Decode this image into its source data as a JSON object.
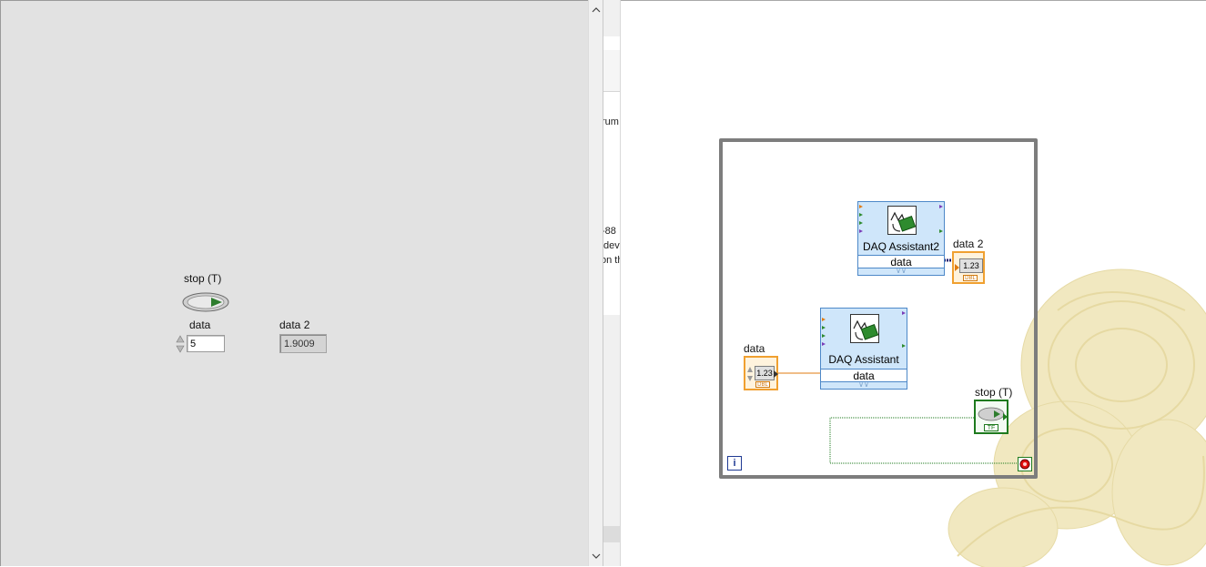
{
  "front_panel": {
    "stop_label": "stop (T)",
    "data_label": "data",
    "data_value": "5",
    "data2_label": "data 2",
    "data2_value": "1.9009"
  },
  "scrollbar": {
    "up_arrow": "^",
    "down_arrow": "v"
  },
  "middle_strip": {
    "text_lines": [
      "rum",
      "-88",
      "dev",
      "on th"
    ]
  },
  "block_diagram": {
    "daq_assistant2_title": "DAQ Assistant2",
    "daq_assistant2_output": "data",
    "daq_assistant_title": "DAQ Assistant",
    "daq_assistant_input": "data",
    "data2_terminal_label": "data 2",
    "data2_terminal_value": "1.23",
    "data2_terminal_type": "DBL",
    "data_terminal_label": "data",
    "data_terminal_value": "1.23",
    "data_terminal_type": "DBL",
    "stop_terminal_label": "stop (T)",
    "stop_terminal_type": "TF",
    "iteration_terminal": "i"
  },
  "colors": {
    "front_panel_bg": "#e2e2e2",
    "loop_border": "#7d7d7d",
    "express_vi_bg": "#cfe6fa",
    "dbl_orange": "#f0a030",
    "boolean_green": "#1e7a1e"
  }
}
